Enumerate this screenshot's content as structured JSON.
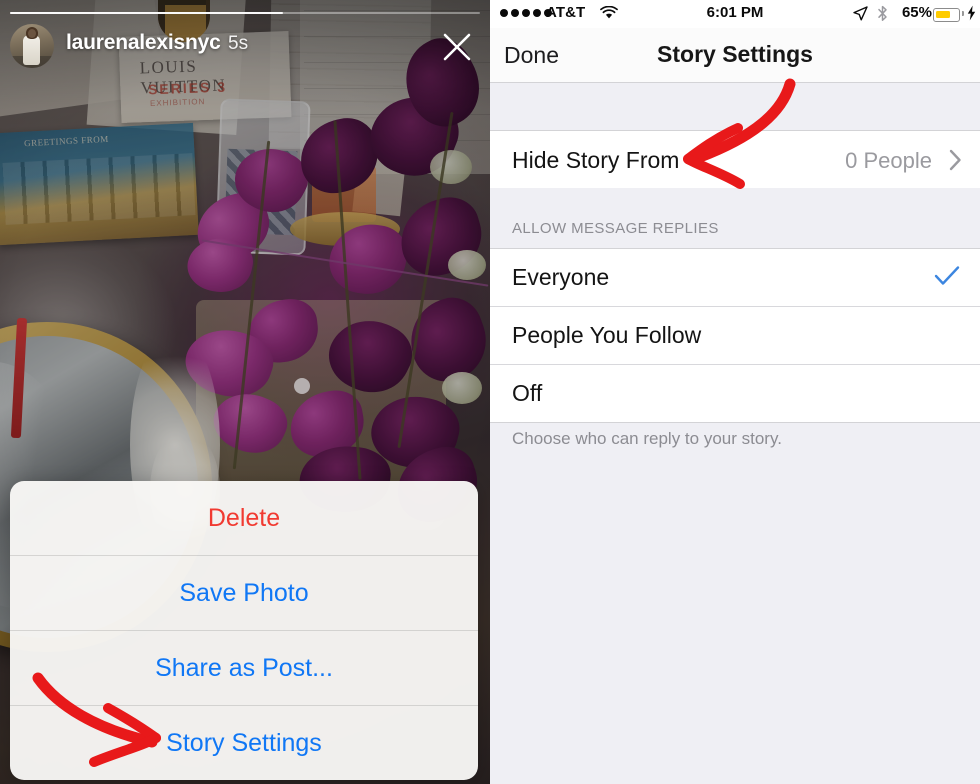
{
  "story": {
    "username": "laurenalexisnyc",
    "timestamp": "5s",
    "close_icon": "close-x-icon",
    "avatar_alt": "user-avatar",
    "progress_percent": 58,
    "action_sheet": {
      "items": [
        {
          "label": "Delete",
          "style": "destructive"
        },
        {
          "label": "Save Photo",
          "style": "normal"
        },
        {
          "label": "Share as Post...",
          "style": "normal"
        },
        {
          "label": "Story Settings",
          "style": "normal"
        }
      ]
    }
  },
  "settings": {
    "status_bar": {
      "signal_dots": 5,
      "carrier": "AT&T",
      "wifi_icon": "wifi-icon",
      "time": "6:01 PM",
      "location_icon": "location-arrow-icon",
      "bluetooth_icon": "bluetooth-icon",
      "battery_percent": "65%",
      "battery_level": 65,
      "battery_color": "#ffcc00",
      "charging_icon": "lightning-bolt-icon"
    },
    "nav": {
      "done_label": "Done",
      "title": "Story Settings"
    },
    "hide_story": {
      "label": "Hide Story From",
      "value": "0 People",
      "chevron_icon": "chevron-right-icon"
    },
    "replies_section": {
      "header": "ALLOW MESSAGE REPLIES",
      "options": [
        {
          "label": "Everyone",
          "selected": true
        },
        {
          "label": "People You Follow",
          "selected": false
        },
        {
          "label": "Off",
          "selected": false
        }
      ],
      "footer": "Choose who can reply to your story.",
      "check_icon": "checkmark-icon",
      "accent_color": "#3c86e0"
    }
  },
  "annotations": {
    "color": "#e8191a",
    "arrows": [
      {
        "name": "arrow-to-hide-story-from",
        "points_at": "Hide Story From"
      },
      {
        "name": "arrow-to-story-settings",
        "points_at": "Story Settings"
      }
    ]
  }
}
